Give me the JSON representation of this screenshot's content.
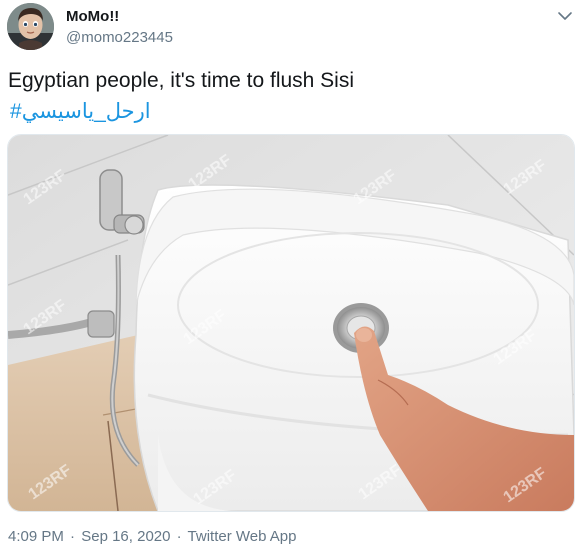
{
  "tweet": {
    "display_name": "MoMo!!",
    "handle": "@momo223445",
    "text": "Egyptian people, it's time to flush Sisi",
    "hashtag": "#ارحل_ياسيسي",
    "time": "4:09 PM",
    "date": "Sep 16, 2020",
    "source": "Twitter Web App",
    "separator": "·"
  },
  "media": {
    "watermark": "123RF",
    "icon": "toilet-flush-photo"
  },
  "icons": {
    "menu": "chevron-down-icon",
    "avatar": "avatar"
  },
  "colors": {
    "link": "#1b95e0",
    "secondary_text": "#657786",
    "primary_text": "#14171a"
  }
}
